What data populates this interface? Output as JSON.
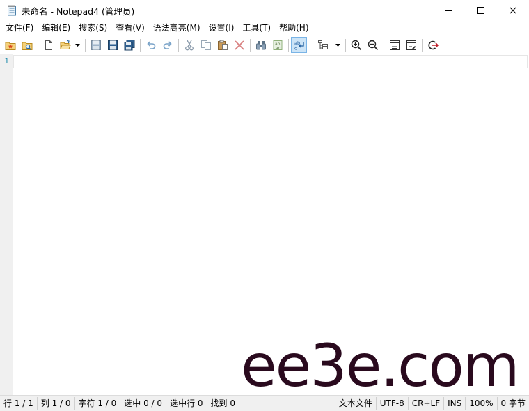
{
  "window": {
    "title": "未命名 - Notepad4 (管理员)",
    "app_icon": "notepad-icon",
    "controls": [
      "minimize-icon",
      "maximize-icon",
      "close-icon"
    ]
  },
  "menu": [
    {
      "label": "文件(F)"
    },
    {
      "label": "编辑(E)"
    },
    {
      "label": "搜索(S)"
    },
    {
      "label": "查看(V)"
    },
    {
      "label": "语法高亮(M)"
    },
    {
      "label": "设置(I)"
    },
    {
      "label": "工具(T)"
    },
    {
      "label": "帮助(H)"
    }
  ],
  "toolbar": {
    "icons": [
      "favorites-icon",
      "browse-folder-icon",
      "new-file-icon",
      "open-folder-icon",
      "save-icon",
      "save-as-icon",
      "save-all-icon",
      "undo-icon",
      "redo-icon",
      "cut-icon",
      "copy-icon",
      "paste-icon",
      "delete-icon",
      "find-icon",
      "replace-icon",
      "word-wrap-icon",
      "scheme-icon",
      "zoom-in-icon",
      "zoom-out-icon",
      "view-icon",
      "properties-icon",
      "exit-icon"
    ],
    "word_wrap_active": true
  },
  "editor": {
    "line_numbers": [
      "1"
    ],
    "content": ""
  },
  "watermark": "ee3e.com",
  "status": {
    "line": "行 1 / 1",
    "column": "列 1 / 0",
    "chars": "字符 1 / 0",
    "selection": "选中 0 / 0",
    "selected_lines": "选中行 0",
    "found": "找到 0",
    "file_type": "文本文件",
    "encoding": "UTF-8",
    "line_ending": "CR+LF",
    "insert_mode": "INS",
    "zoom": "100%",
    "size": "0 字节"
  },
  "colors": {
    "line_number": "#2b91af",
    "gutter": "#f0f0f0",
    "active_toolbar": "#cce4f7",
    "watermark": "#2a0a1e"
  }
}
